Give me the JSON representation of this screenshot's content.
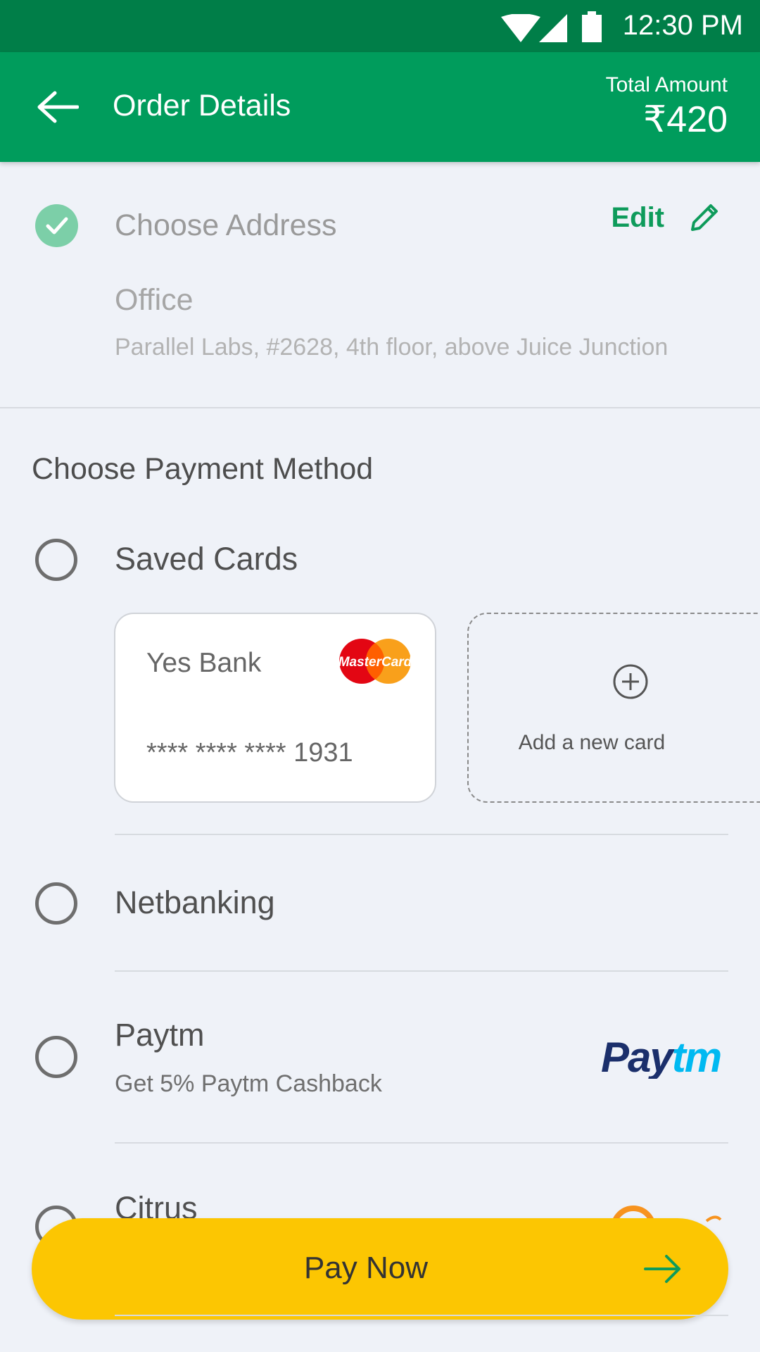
{
  "status_bar": {
    "time": "12:30 PM"
  },
  "app_bar": {
    "title": "Order Details",
    "total_label": "Total Amount",
    "total_value": "₹420"
  },
  "address": {
    "title": "Choose Address",
    "edit_label": "Edit",
    "name": "Office",
    "line": "Parallel Labs, #2628, 4th floor, above Juice Junction"
  },
  "payment": {
    "heading": "Choose Payment Method",
    "saved_cards": {
      "label": "Saved Cards",
      "card": {
        "bank": "Yes Bank",
        "number": "**** **** **** 1931",
        "brand_icon": "mastercard-logo"
      },
      "add_card_label": "Add a new card"
    },
    "netbanking": {
      "label": "Netbanking"
    },
    "paytm": {
      "label": "Paytm",
      "subtitle": "Get 5% Paytm Cashback",
      "logo_text": "Paytm"
    },
    "citrus": {
      "label": "Citrus"
    }
  },
  "pay_button": {
    "label": "Pay Now"
  },
  "colors": {
    "status_bar": "#007e48",
    "app_bar": "#009c5c",
    "accent_green": "#0e9b5b",
    "pay_button": "#fcc602",
    "background": "#eff2f8"
  }
}
